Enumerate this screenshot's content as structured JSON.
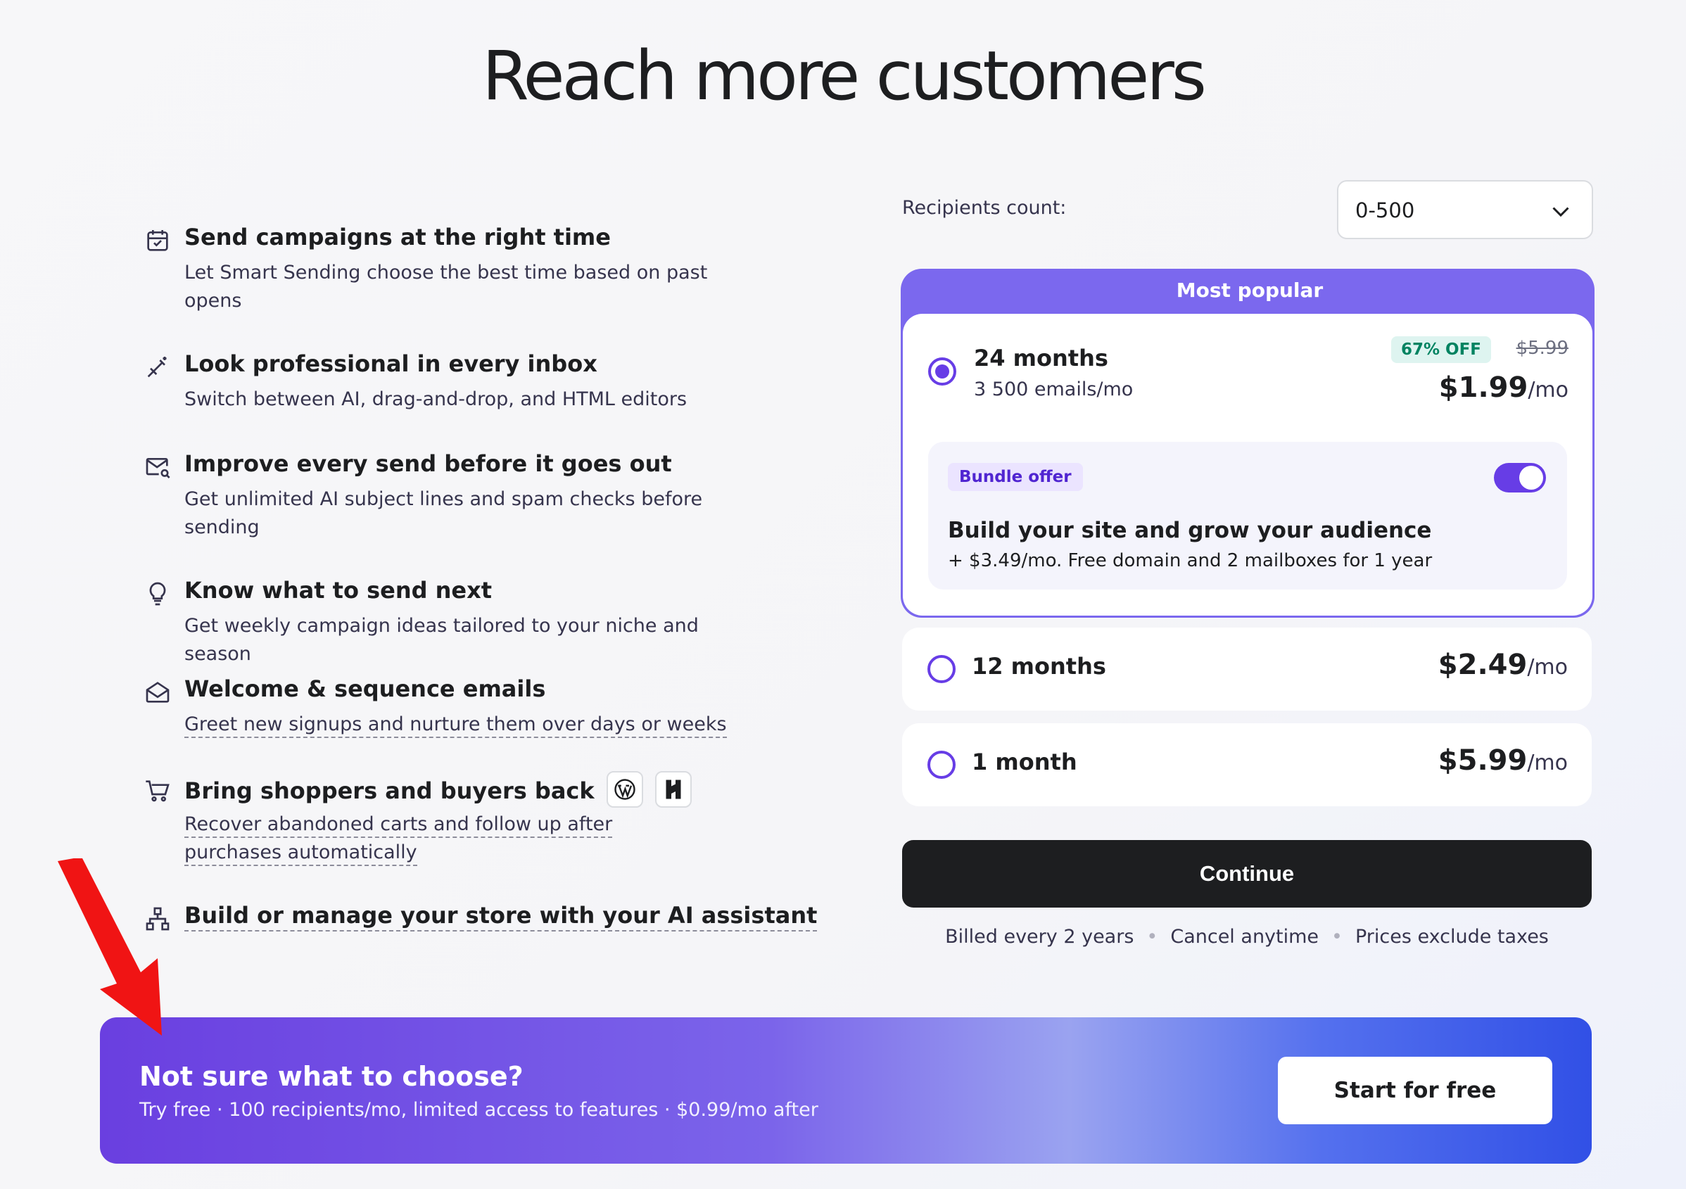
{
  "page": {
    "title": "Reach more customers"
  },
  "features": [
    {
      "title": "Send campaigns at the right time",
      "desc": "Let Smart Sending choose the best time based on past opens",
      "icon": "calendar-check-icon"
    },
    {
      "title": "Look professional in every inbox",
      "desc": "Switch between AI, drag-and-drop, and HTML editors",
      "icon": "magic-wand-icon"
    },
    {
      "title": "Improve every send before it goes out",
      "desc": "Get unlimited AI subject lines and spam checks before sending",
      "icon": "mail-search-icon"
    },
    {
      "title": "Know what to send next",
      "desc": "Get weekly campaign ideas tailored to your niche and season",
      "icon": "lightbulb-icon"
    },
    {
      "title": "Welcome & sequence emails",
      "desc": "Greet new signups and nurture them over days or weeks",
      "icon": "envelope-open-icon"
    },
    {
      "title": "Bring shoppers and buyers back",
      "desc": "Recover abandoned carts and follow up after purchases automatically",
      "icon": "cart-icon"
    },
    {
      "title": "Build or manage your store with your AI assistant",
      "desc": "",
      "icon": "sitemap-icon"
    }
  ],
  "recipients": {
    "label": "Recipients count:",
    "value": "0-500"
  },
  "popular": {
    "badge": "Most popular",
    "plan": "24 months",
    "emails": "3 500 emails/mo",
    "discount": "67% OFF",
    "old_price": "$5.99",
    "price": "$1.99",
    "per": "/mo",
    "bundle": {
      "tag": "Bundle offer",
      "title": "Build your site and grow your audience",
      "desc": "+ $3.49/mo. Free domain and 2 mailboxes for 1 year",
      "enabled": true
    }
  },
  "plans": [
    {
      "name": "12 months",
      "price": "$2.49",
      "per": "/mo"
    },
    {
      "name": "1 month",
      "price": "$5.99",
      "per": "/mo"
    }
  ],
  "continue_label": "Continue",
  "billing_notes": [
    "Billed every 2 years",
    "Cancel anytime",
    "Prices exclude taxes"
  ],
  "banner": {
    "title": "Not sure what to choose?",
    "subtitle": "Try free · 100 recipients/mo, limited access to features · $0.99/mo after",
    "button": "Start for free"
  },
  "colors": {
    "accent": "#673de6",
    "popular_header": "#7b68ee",
    "discount_bg": "#def4f0",
    "discount_text": "#008361",
    "arrow": "#f01414"
  }
}
